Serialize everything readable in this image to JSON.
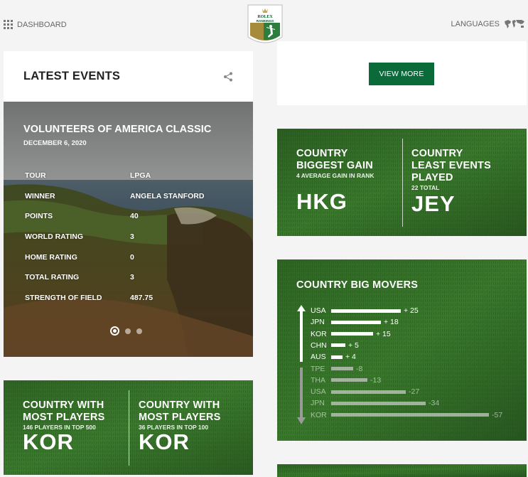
{
  "header": {
    "dashboard_label": "DASHBOARD",
    "languages_label": "LANGUAGES",
    "logo_text": [
      "ROLEX",
      "RANKINGS"
    ]
  },
  "latest_events": {
    "title": "LATEST EVENTS",
    "event": {
      "name": "VOLUNTEERS OF AMERICA CLASSIC",
      "date": "DECEMBER 6, 2020",
      "rows": [
        {
          "label": "TOUR",
          "value": "LPGA"
        },
        {
          "label": "WINNER",
          "value": "ANGELA STANFORD"
        },
        {
          "label": "POINTS",
          "value": "40"
        },
        {
          "label": "WORLD RATING",
          "value": "3"
        },
        {
          "label": "HOME RATING",
          "value": "0"
        },
        {
          "label": "TOTAL RATING",
          "value": "3"
        },
        {
          "label": "STRENGTH OF FIELD",
          "value": "487.75"
        }
      ]
    },
    "carousel": {
      "count": 3,
      "active": 0
    }
  },
  "view_more_label": "VIEW MORE",
  "biggest_gain": {
    "title": [
      "COUNTRY",
      "BIGGEST GAIN"
    ],
    "sub": "4 AVERAGE GAIN IN RANK",
    "value": "HKG"
  },
  "least_events": {
    "title": [
      "COUNTRY",
      "LEAST EVENTS",
      "PLAYED"
    ],
    "sub": "22 TOTAL",
    "value": "JEY"
  },
  "most_players_500": {
    "title": [
      "COUNTRY WITH",
      "MOST PLAYERS"
    ],
    "sub": "146 PLAYERS IN TOP 500",
    "value": "KOR"
  },
  "most_players_100": {
    "title": [
      "COUNTRY WITH",
      "MOST PLAYERS"
    ],
    "sub": "36 PLAYERS IN TOP 100",
    "value": "KOR"
  },
  "big_movers": {
    "title": "COUNTRY BIG MOVERS",
    "up": [
      {
        "country": "USA",
        "change": 25,
        "label": "+ 25"
      },
      {
        "country": "JPN",
        "change": 18,
        "label": "+ 18"
      },
      {
        "country": "KOR",
        "change": 15,
        "label": "+ 15"
      },
      {
        "country": "CHN",
        "change": 5,
        "label": "+ 5"
      },
      {
        "country": "AUS",
        "change": 4,
        "label": "+ 4"
      }
    ],
    "down": [
      {
        "country": "TPE",
        "change": -8,
        "label": "-8"
      },
      {
        "country": "THA",
        "change": -13,
        "label": "-13"
      },
      {
        "country": "USA",
        "change": -27,
        "label": "-27"
      },
      {
        "country": "JPN",
        "change": -34,
        "label": "-34"
      },
      {
        "country": "KOR",
        "change": -57,
        "label": "-57"
      }
    ]
  },
  "colors": {
    "brand_green": "#0a6a3a",
    "grass": "#2f6a25",
    "gold": "#a58b3b"
  }
}
